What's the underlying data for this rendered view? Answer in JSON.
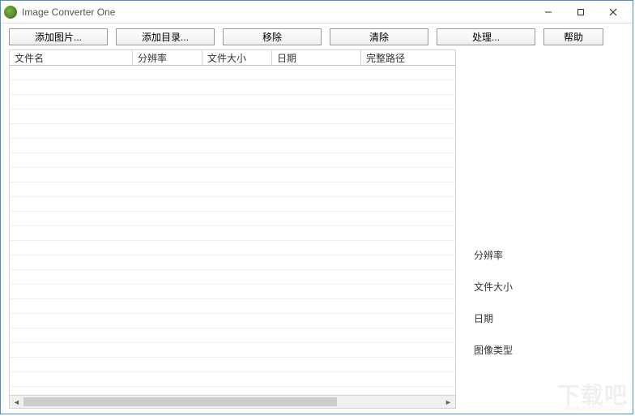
{
  "window": {
    "title": "Image Converter One"
  },
  "toolbar": {
    "add_image": "添加图片...",
    "add_folder": "添加目录...",
    "remove": "移除",
    "clear": "清除",
    "process": "处理...",
    "help": "帮助"
  },
  "table": {
    "columns": [
      "文件名",
      "分辨率",
      "文件大小",
      "日期",
      "完整路径"
    ],
    "rows": []
  },
  "side": {
    "resolution": "分辨率",
    "filesize": "文件大小",
    "date": "日期",
    "imagetype": "图像类型"
  },
  "watermark": {
    "main": "下载吧",
    "sub": "www.xiazaiba.com"
  }
}
